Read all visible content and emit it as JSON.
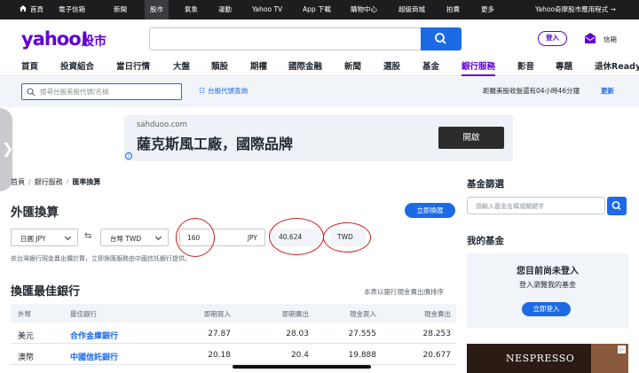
{
  "topbar": {
    "items": [
      "首頁",
      "電子信箱",
      "新聞",
      "股市",
      "氣象",
      "運動",
      "Yahoo TV",
      "App 下載",
      "購物中心",
      "超級商城",
      "拍賣",
      "更多"
    ],
    "active": "股市",
    "app_label": "Yahoo奇摩股市應用程式 →"
  },
  "header": {
    "logo": "yahoo!",
    "logo_sub": "股市",
    "login_label": "登入",
    "mail_label": "信箱"
  },
  "nav": {
    "items": [
      "首頁",
      "投資組合",
      "當日行情",
      "大盤",
      "類股",
      "期權",
      "國際金融",
      "新聞",
      "選股",
      "基金",
      "銀行服務",
      "影音",
      "專題",
      "退休Ready"
    ],
    "active": "銀行服務"
  },
  "subbar": {
    "search_placeholder": "搜尋台股美股代號/名稱",
    "code_lookup": "台股代號查詢",
    "market_status": "距離美股收盤還有04小時46分鐘",
    "refresh": "更新"
  },
  "ad": {
    "domain": "sahduoo.com",
    "title": "薩克斯風工廠，國際品牌",
    "button": "開啟",
    "info": "i"
  },
  "breadcrumb": [
    "首頁",
    "銀行服務",
    "匯率換算"
  ],
  "converter": {
    "title": "外匯換算",
    "exchange_button": "立即換匯",
    "from_currency": "日圓 JPY",
    "to_currency": "台幣 TWD",
    "swap_icon": "⇆",
    "amount": "160",
    "amount_currency": "JPY",
    "result": "40.624",
    "result_currency": "TWD",
    "note": "依台灣銀行現金賣出價計算，立即換匯服務由中國信託銀行提供。"
  },
  "best_bank": {
    "title": "換匯最佳銀行",
    "sort_note": "本表以銀行現金賣出價排序",
    "headers": [
      "外幣",
      "最佳銀行",
      "即期買入",
      "即期賣出",
      "現金買入",
      "現金賣出"
    ],
    "rows": [
      [
        "美元",
        "合作金庫銀行",
        "27.87",
        "28.03",
        "27.555",
        "28.253"
      ],
      [
        "澳幣",
        "中國信託銀行",
        "20.18",
        "20.4",
        "19.888",
        "20.677"
      ]
    ]
  },
  "sidebar": {
    "fund_screen_title": "基金篩選",
    "fund_search_placeholder": "請輸入基金名稱或關鍵字",
    "my_fund_title": "我的基金",
    "not_logged_in": "您目前尚未登入",
    "login_prompt": "登入瀏覽我的基金",
    "login_button": "立即登入",
    "ad_text": "NESPRESSO"
  },
  "colors": {
    "brand": "#6001d2",
    "accent": "#1d6ae5",
    "annotation": "#c8201d"
  }
}
